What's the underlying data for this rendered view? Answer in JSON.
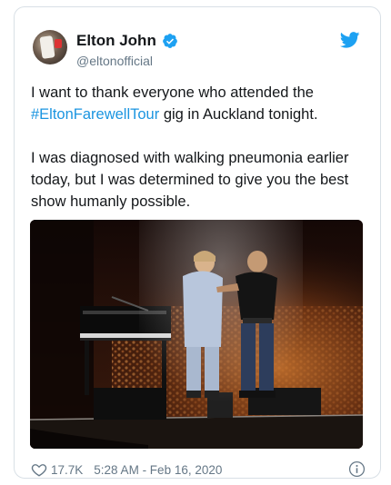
{
  "user": {
    "display_name": "Elton John",
    "handle": "@eltonofficial"
  },
  "tweet": {
    "line1_before": "I want to thank everyone who attended the ",
    "hashtag": "#EltonFarewellTour",
    "line1_after": " gig in Auckland tonight.",
    "paragraph2": "I was diagnosed with walking pneumonia earlier today, but I was determined to give you the best show humanly possible."
  },
  "footer": {
    "likes": "17.7K",
    "timestamp": "5:28 AM - Feb 16, 2020"
  },
  "icons": {
    "verified": "verified-badge-icon",
    "brand": "twitter-bird-icon",
    "like": "heart-icon",
    "info": "info-icon"
  },
  "colors": {
    "brand": "#1da1f2",
    "hashtag": "#1b95e0",
    "secondary_text": "#657786"
  }
}
